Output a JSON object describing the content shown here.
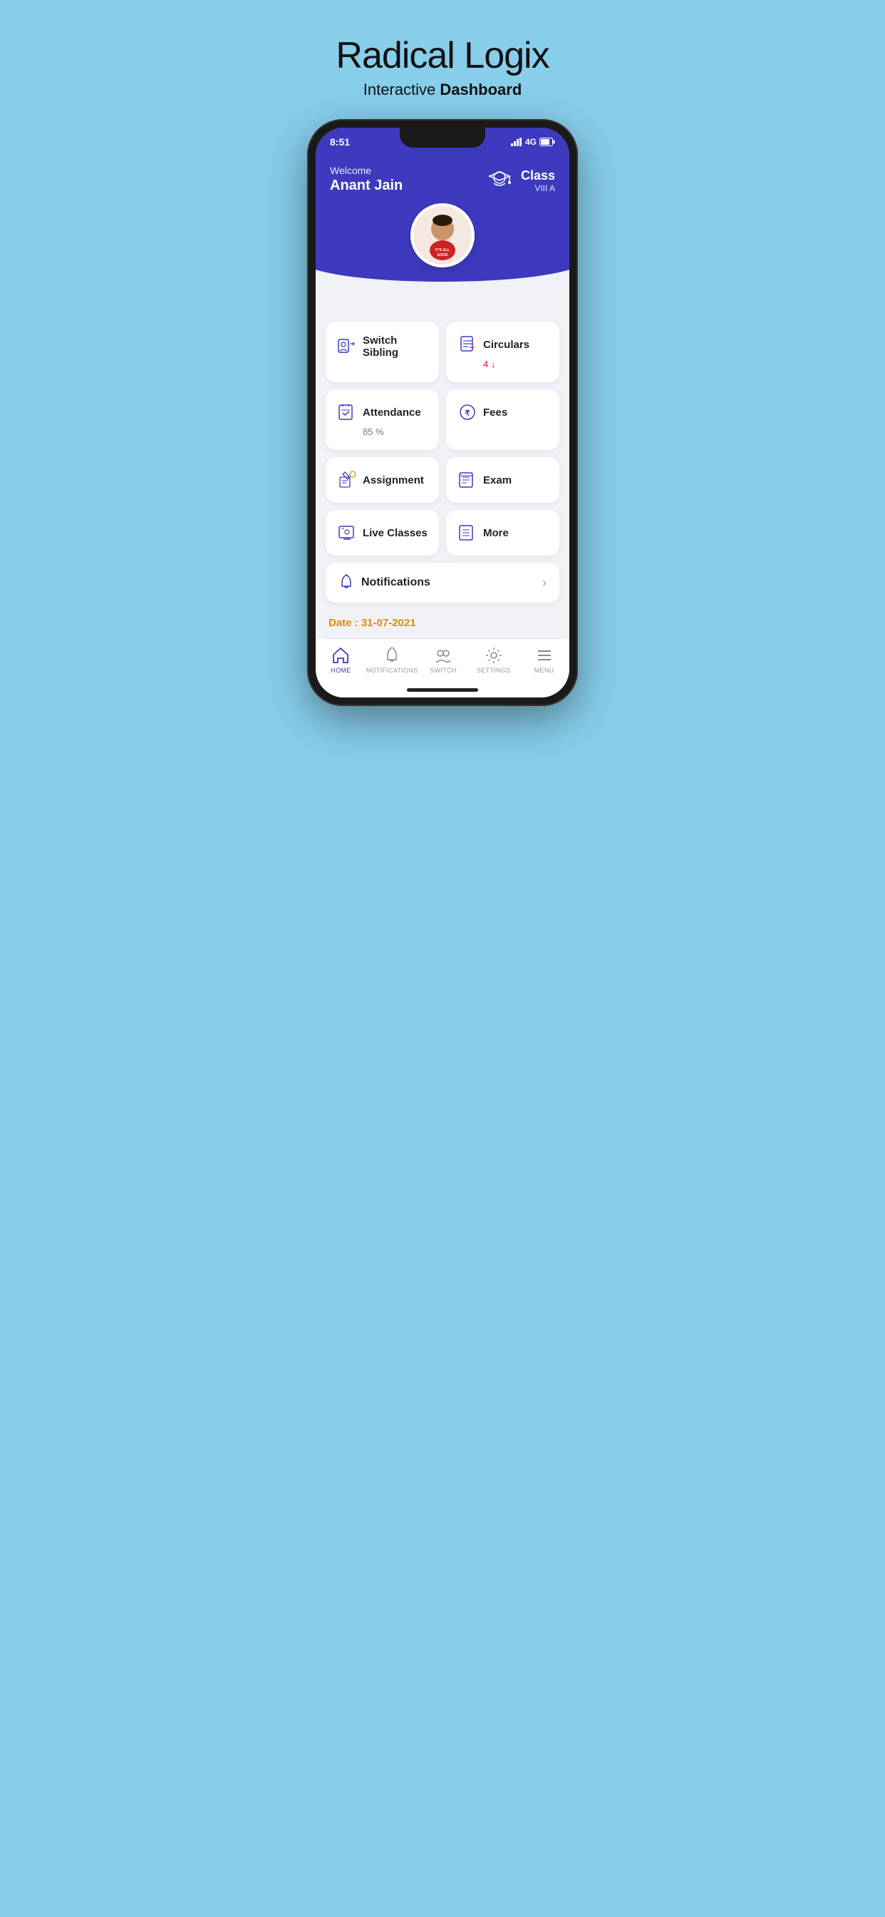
{
  "page": {
    "bg_color": "#87CEEB",
    "title": "Radical Logix",
    "subtitle_plain": "Interactive ",
    "subtitle_bold": "Dashboard"
  },
  "status_bar": {
    "time": "8:51",
    "signal": "4G"
  },
  "header": {
    "welcome": "Welcome",
    "student_name": "Anant  Jain",
    "class_label": "Class",
    "class_value": "VIII A"
  },
  "menu_items": [
    {
      "id": "switch-sibling",
      "title": "Switch Sibling",
      "subtitle": null,
      "count": null
    },
    {
      "id": "circulars",
      "title": "Circulars",
      "subtitle": null,
      "count": "4 ↓"
    },
    {
      "id": "attendance",
      "title": "Attendance",
      "subtitle": "85 %",
      "count": null
    },
    {
      "id": "fees",
      "title": "Fees",
      "subtitle": null,
      "count": null
    },
    {
      "id": "assignment",
      "title": "Assignment",
      "subtitle": null,
      "count": null
    },
    {
      "id": "exam",
      "title": "Exam",
      "subtitle": null,
      "count": null
    },
    {
      "id": "live-classes",
      "title": "Live Classes",
      "subtitle": null,
      "count": null
    },
    {
      "id": "more",
      "title": "More",
      "subtitle": null,
      "count": null
    }
  ],
  "notifications": {
    "label": "Notifications"
  },
  "date": {
    "label": "Date : 31-07-2021"
  },
  "bottom_nav": [
    {
      "id": "home",
      "label": "HOME",
      "active": true
    },
    {
      "id": "notifications",
      "label": "NOTIFICATIONS",
      "active": false
    },
    {
      "id": "switch",
      "label": "SWITCH",
      "active": false
    },
    {
      "id": "settings",
      "label": "SETTINGS",
      "active": false
    },
    {
      "id": "menu",
      "label": "MENU",
      "active": false
    }
  ],
  "colors": {
    "primary": "#3d3abf",
    "accent": "#e08c00",
    "bg": "#f0f2f8"
  }
}
